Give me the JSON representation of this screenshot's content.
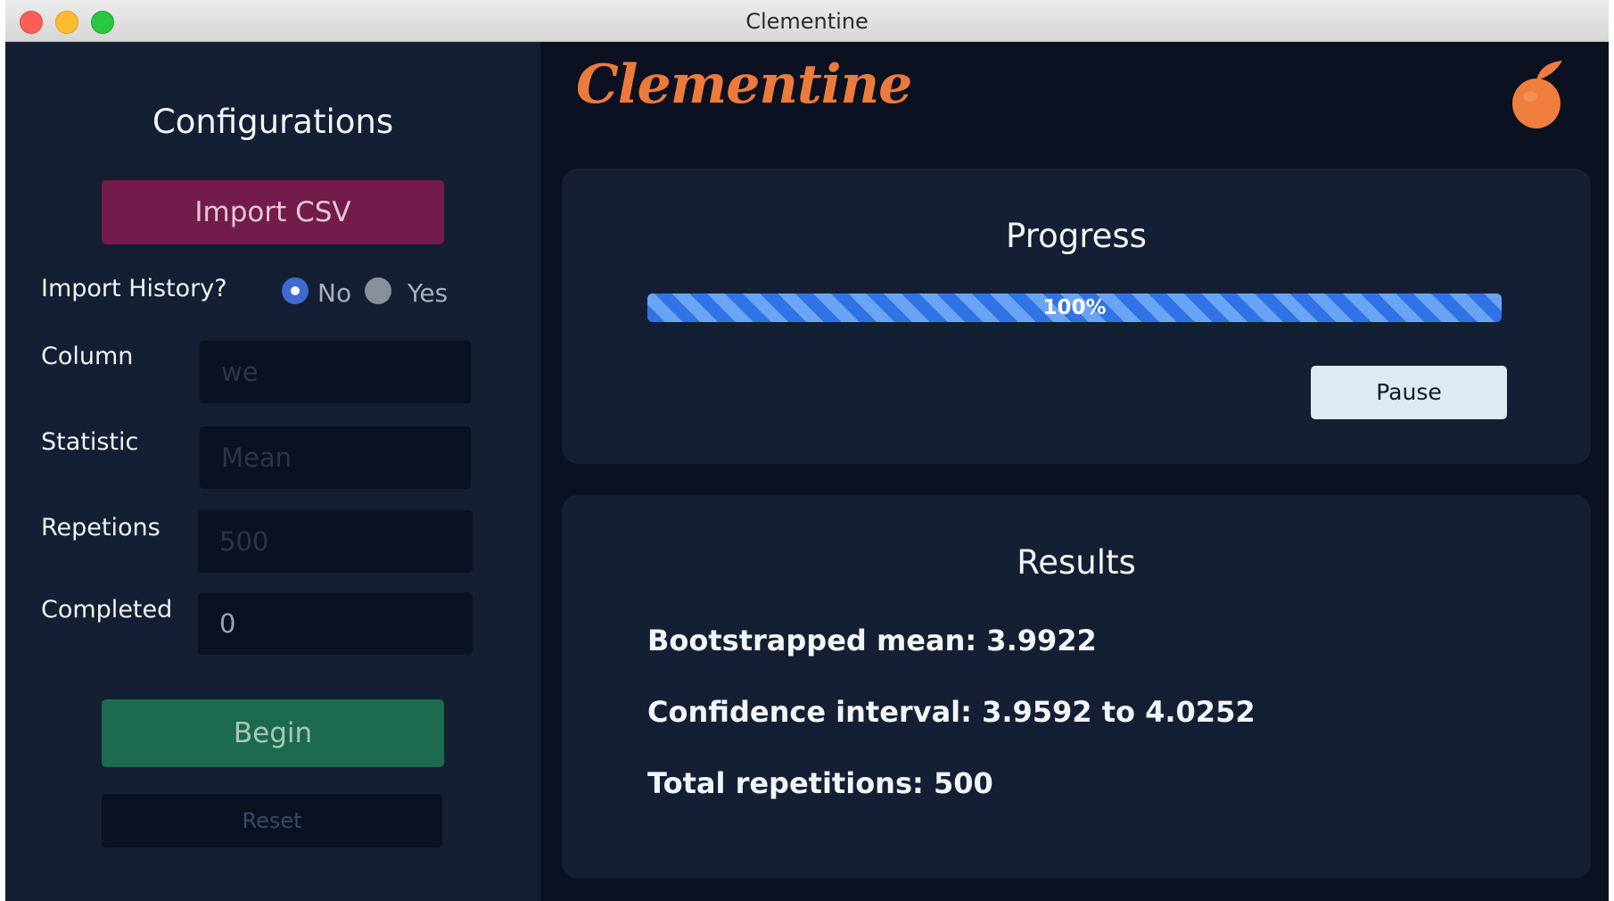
{
  "window": {
    "title": "Clementine"
  },
  "sidebar": {
    "heading": "Configurations",
    "import_button": "Import CSV",
    "import_history": {
      "label": "Import History?",
      "options": [
        "No",
        "Yes"
      ],
      "selected": "No"
    },
    "fields": {
      "column": {
        "label": "Column",
        "placeholder": "we"
      },
      "statistic": {
        "label": "Statistic",
        "placeholder": "Mean"
      },
      "repetitions": {
        "label": "Repetions",
        "placeholder": "500"
      },
      "completed": {
        "label": "Completed",
        "value": "0"
      }
    },
    "begin_button": "Begin",
    "reset_button": "Reset"
  },
  "header": {
    "logo_text": "Clementine",
    "logo_icon": "clementine-fruit-icon",
    "logo_color": "#ec7b3b"
  },
  "progress": {
    "heading": "Progress",
    "percent": 100,
    "label": "100%",
    "pause_button": "Pause"
  },
  "results": {
    "heading": "Results",
    "lines": [
      "Bootstrapped mean: 3.9922",
      "Confidence interval: 3.9592 to 4.0252",
      "Total repetitions: 500"
    ]
  },
  "colors": {
    "background": "#0b1120",
    "panel": "#151f33",
    "import_button": "#731b4a",
    "begin_button": "#1d6b4e",
    "progress_bar": "#2f73e6",
    "pause_button": "#dbeaf3"
  }
}
